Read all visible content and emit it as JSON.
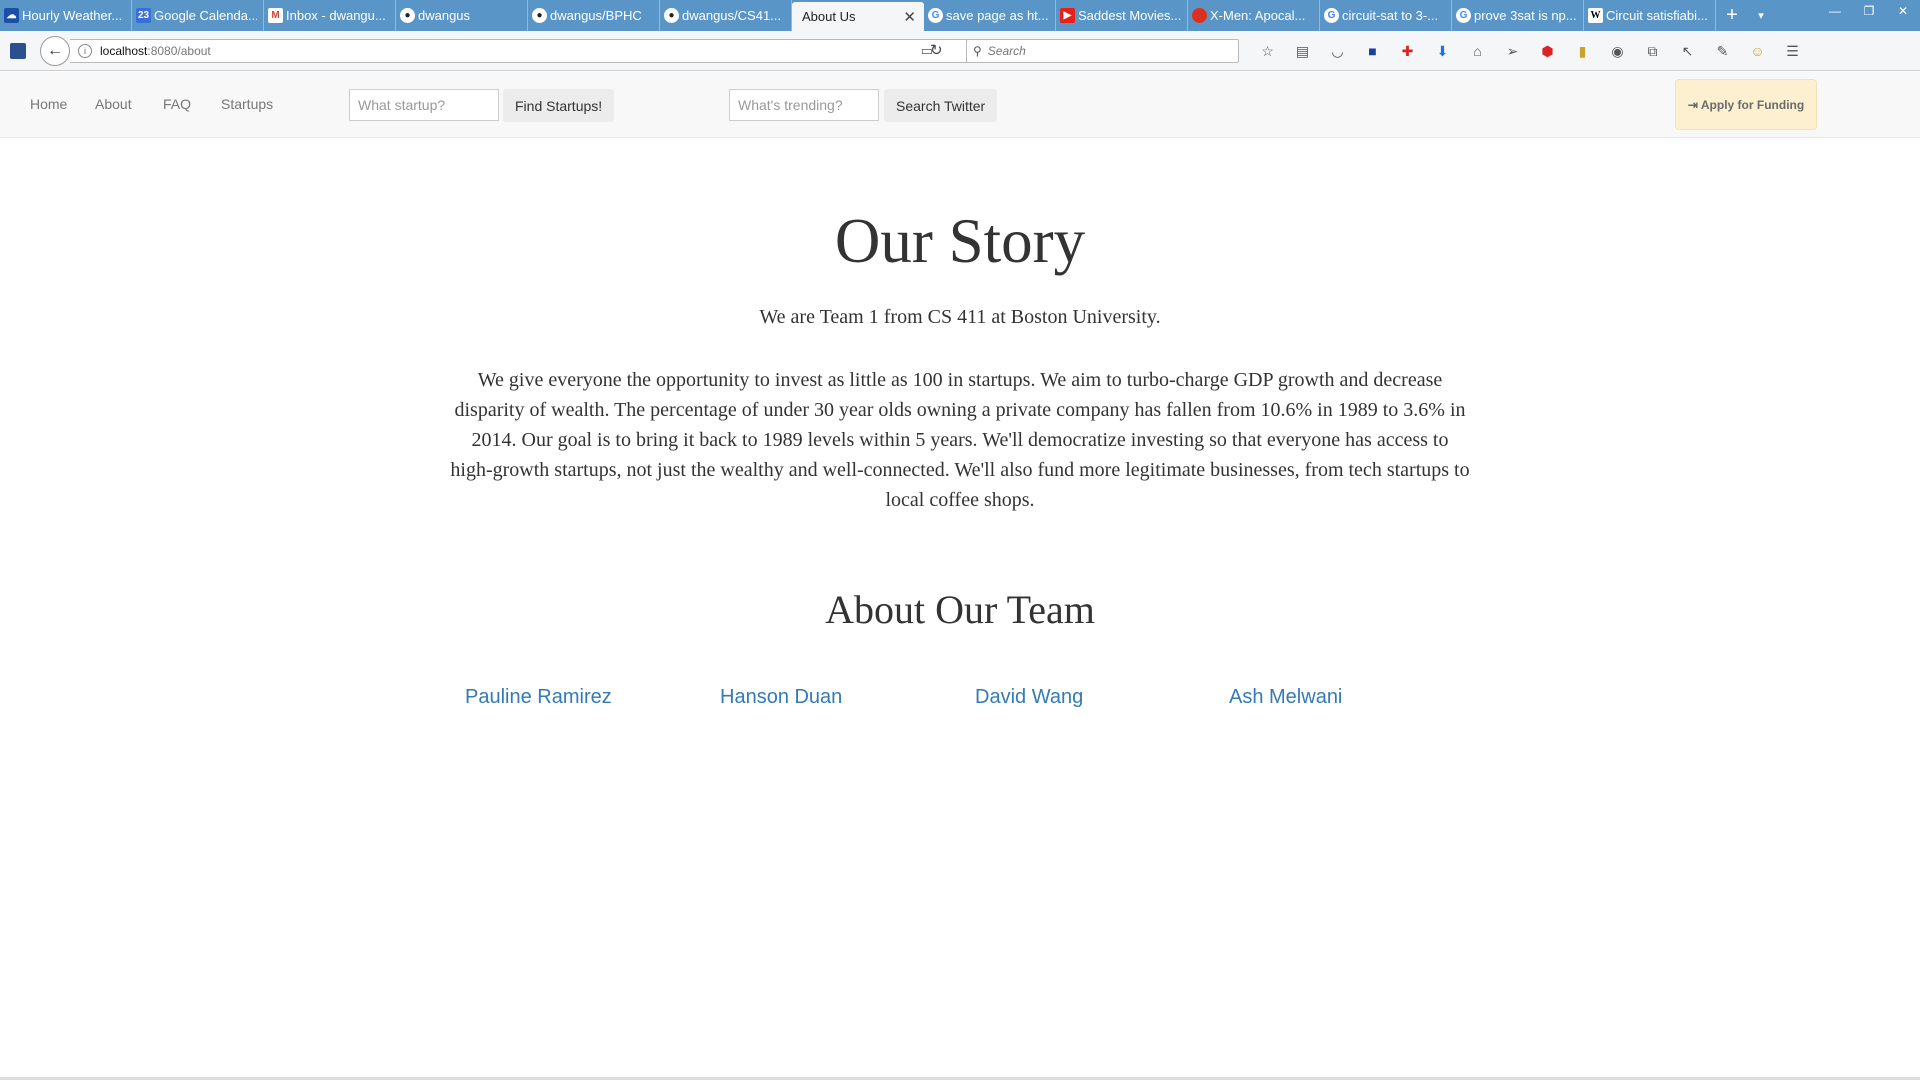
{
  "browser": {
    "tabs": [
      {
        "label": "Hourly Weather...",
        "icon": "weather-icon",
        "color": "#1e4fa8"
      },
      {
        "label": "Google Calenda...",
        "icon": "calendar-icon",
        "color": "#3b6fd8"
      },
      {
        "label": "Inbox - dwangu...",
        "icon": "gmail-icon",
        "color": "#d44638"
      },
      {
        "label": "dwangus",
        "icon": "github-icon",
        "color": "#222222"
      },
      {
        "label": "dwangus/BPHC",
        "icon": "github-icon",
        "color": "#222222"
      },
      {
        "label": "dwangus/CS41...",
        "icon": "github-icon",
        "color": "#222222"
      },
      {
        "label": "About Us",
        "icon": "",
        "color": "#f5f6f7",
        "active": true
      },
      {
        "label": "save page as ht...",
        "icon": "google-icon",
        "color": "#4285f4"
      },
      {
        "label": "Saddest Movies...",
        "icon": "youtube-icon",
        "color": "#e62117"
      },
      {
        "label": "X-Men: Apocal...",
        "icon": "tomato-icon",
        "color": "#d9301f"
      },
      {
        "label": "circuit-sat to 3-...",
        "icon": "google-icon",
        "color": "#4285f4"
      },
      {
        "label": "prove 3sat is np...",
        "icon": "google-icon",
        "color": "#4285f4"
      },
      {
        "label": "Circuit satisfiabi...",
        "icon": "wikipedia-icon",
        "color": "#ffffff"
      }
    ],
    "url_host": "localhost",
    "url_path": ":8080/about",
    "search_placeholder": "Search"
  },
  "site_nav": {
    "links": [
      "Home",
      "About",
      "FAQ",
      "Startups"
    ],
    "startup_placeholder": "What startup?",
    "find_label": "Find Startups!",
    "trending_placeholder": "What's trending?",
    "twitter_label": "Search Twitter",
    "funding_label": "Apply for Funding"
  },
  "main": {
    "title": "Our Story",
    "intro": "We are Team 1 from CS 411 at Boston University.",
    "body": "We give everyone the opportunity to invest as little as 100 in startups. We aim to turbo-charge GDP growth and decrease disparity of wealth. The percentage of under 30 year olds owning a private company has fallen from 10.6% in 1989 to 3.6% in 2014. Our goal is to bring it back to 1989 levels within 5 years. We'll democratize investing so that everyone has access to high-growth startups, not just the wealthy and well-connected. We'll also fund more legitimate businesses, from tech startups to local coffee shops.",
    "team_title": "About Our Team",
    "team": [
      "Pauline Ramirez",
      "Hanson Duan",
      "David Wang",
      "Ash Melwani"
    ]
  },
  "colors": {
    "tabstrip": "#5a95c8",
    "link": "#337ab7",
    "funding_bg": "#fdf0d0"
  }
}
